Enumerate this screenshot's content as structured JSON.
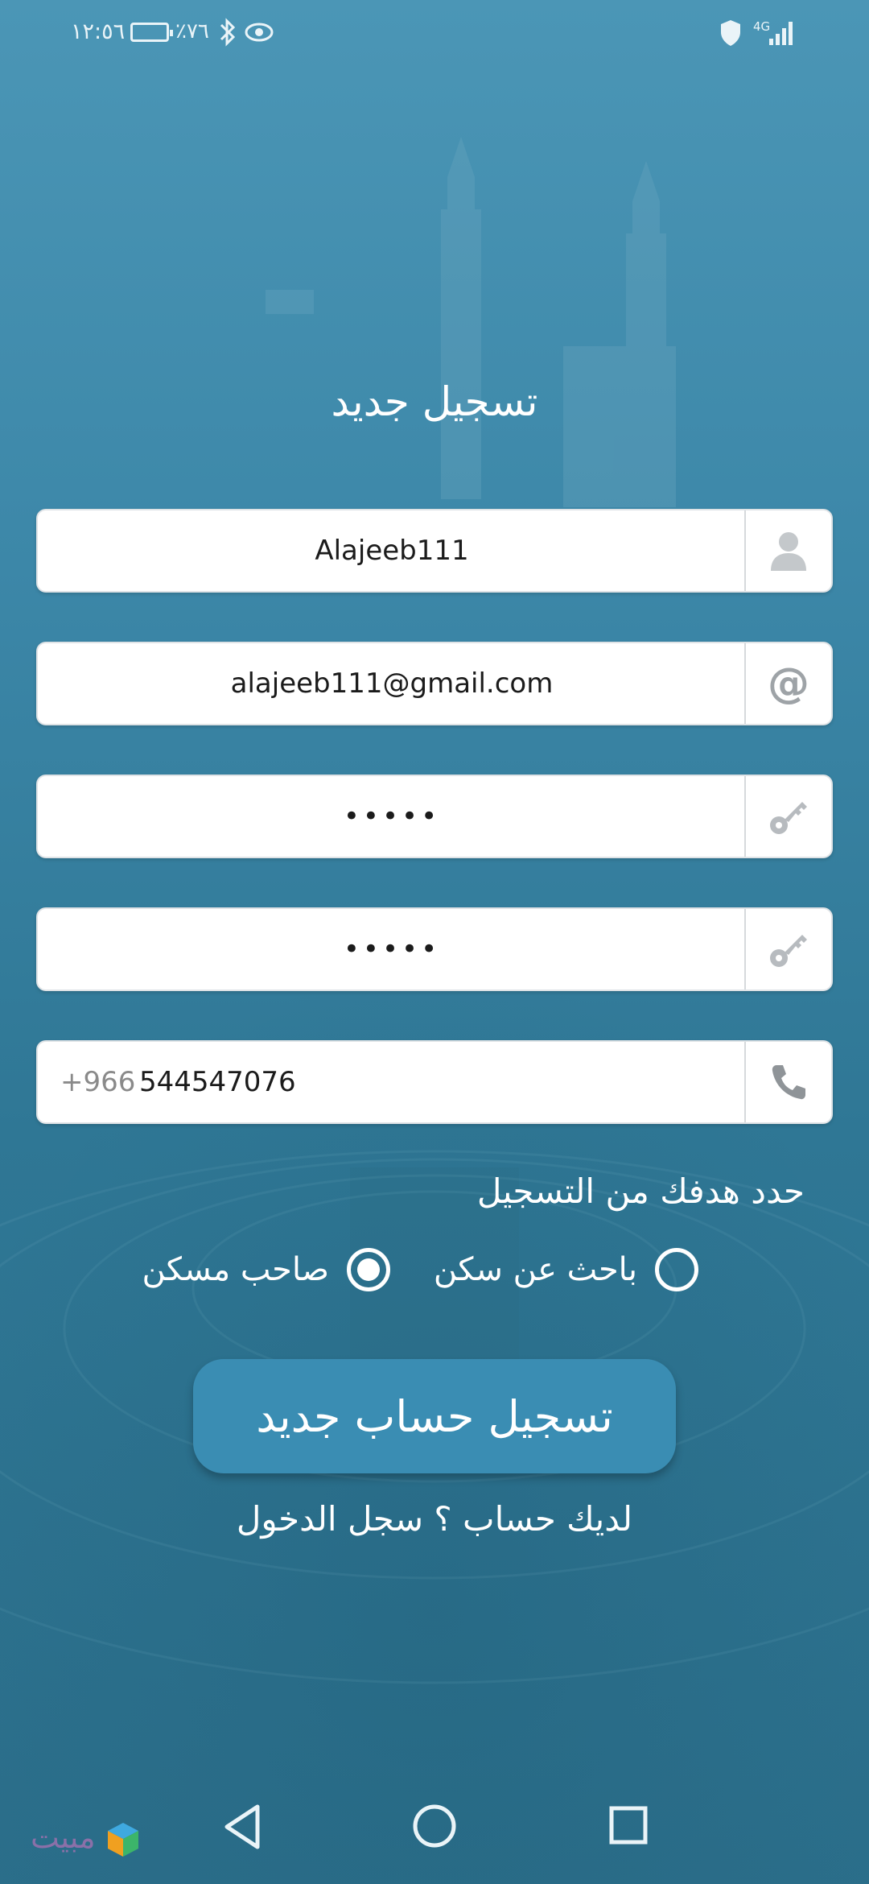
{
  "status_bar": {
    "time": "١٢:٥٦",
    "battery": "٪٧٦",
    "network": "4G"
  },
  "form": {
    "title": "تسجيل جديد",
    "username": {
      "value": "Alajeeb111",
      "icon": "person-icon"
    },
    "email": {
      "value": "alajeeb111@gmail.com",
      "icon": "at-icon"
    },
    "password": {
      "value": "•••••",
      "icon": "key-icon"
    },
    "confirm_password": {
      "value": "•••••",
      "icon": "key-icon"
    },
    "phone": {
      "prefix": "+966",
      "value": "544547076",
      "icon": "phone-icon"
    }
  },
  "goal": {
    "label": "حدد هدفك من التسجيل",
    "options": [
      {
        "label": "باحث عن سكن",
        "selected": false
      },
      {
        "label": "صاحب مسكن",
        "selected": true
      }
    ]
  },
  "buttons": {
    "register": "تسجيل حساب جديد",
    "login_link": "لديك حساب ؟ سجل الدخول"
  },
  "watermark": {
    "text": "مبيت"
  },
  "colors": {
    "accent": "#3a8db3",
    "background": "#3c87a8"
  }
}
